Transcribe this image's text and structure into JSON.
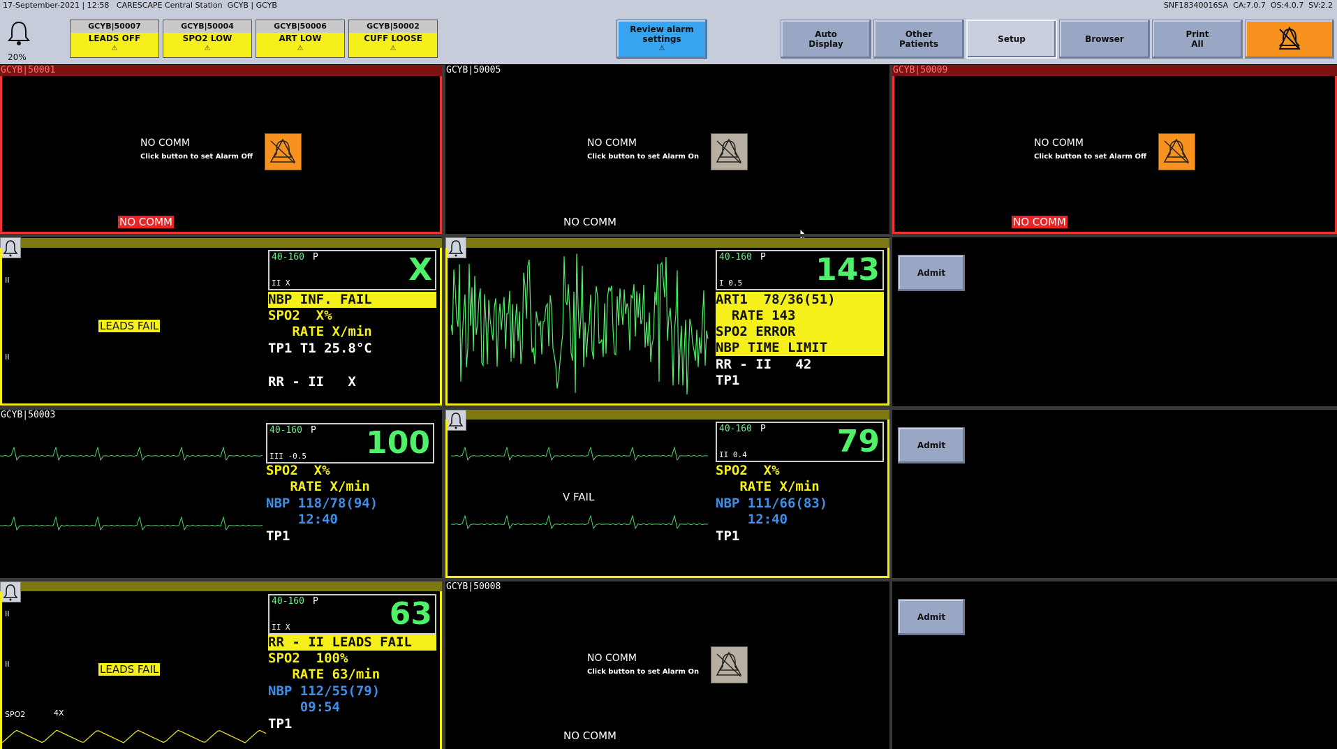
{
  "topbar": {
    "info_left": "17-September-2021 | 12:58   CARESCAPE Central Station  GCYB | GCYB",
    "info_right": "SNF18340016SA  CA:7.0.7  OS:4.0.7  SV:2.2",
    "volume": "20%",
    "bell_icon": "bell-icon"
  },
  "alarm_tiles": [
    {
      "bed": "GCYB|50007",
      "label": "LEADS OFF"
    },
    {
      "bed": "GCYB|50004",
      "label": "SPO2 LOW"
    },
    {
      "bed": "GCYB|50006",
      "label": "ART LOW"
    },
    {
      "bed": "GCYB|50002",
      "label": "CUFF LOOSE"
    }
  ],
  "buttons": {
    "review_alarm_l1": "Review alarm",
    "review_alarm_l2": "settings",
    "auto_display_l1": "Auto",
    "auto_display_l2": "Display",
    "other_patients_l1": "Other",
    "other_patients_l2": "Patients",
    "setup": "Setup",
    "browser": "Browser",
    "print_l1": "Print",
    "print_l2": "All",
    "silence_icon": "alarm-silence-icon"
  },
  "beds": {
    "b50001": {
      "title": "GCYB|50001",
      "nocomm": "NO COMM",
      "click": "Click button to set Alarm Off",
      "status": "NO COMM"
    },
    "b50005": {
      "title": "GCYB|50005",
      "nocomm": "NO COMM",
      "click": "Click button to set Alarm On",
      "status": "NO COMM"
    },
    "b50009": {
      "title": "GCYB|50009",
      "nocomm": "NO COMM",
      "click": "Click button to set Alarm Off",
      "status": "NO COMM"
    },
    "b50008": {
      "title": "GCYB|50008",
      "nocomm": "NO COMM",
      "click": "Click button to set Alarm On",
      "status": "NO COMM"
    },
    "b50003": {
      "title": "GCYB|50003"
    }
  },
  "monitors": {
    "m1": {
      "limits": "40-160",
      "p": "P",
      "lead": "II  X",
      "hr": "X",
      "leads_fail": "LEADS FAIL",
      "lead_label_top": "II",
      "lead_label_bot": "II",
      "lines": [
        "NBP INF. FAIL",
        "SPO2  X%",
        "   RATE X/min",
        "TP1 T1 25.8°C",
        "",
        "RR - II   X"
      ]
    },
    "m2": {
      "limits": "40-160",
      "p": "P",
      "lead": "I 0.5",
      "hr": "143",
      "lines": [
        "ART1  78/36(51)",
        "  RATE 143",
        "SPO2 ERROR",
        "NBP TIME LIMIT",
        "RR - II   42",
        "TP1"
      ]
    },
    "m3": {
      "limits": "40-160",
      "p": "P",
      "lead": "III -0.5",
      "hr": "100",
      "lines": [
        "SPO2  X%",
        "   RATE X/min",
        "NBP 118/78(94)",
        "    12:40",
        "TP1"
      ]
    },
    "m4": {
      "limits": "40-160",
      "p": "P",
      "lead": "II 0.4",
      "hr": "79",
      "vfail": "V FAIL",
      "lines": [
        "SPO2  X%",
        "   RATE X/min",
        "NBP 111/66(83)",
        "    12:40",
        "TP1"
      ]
    },
    "m5": {
      "limits": "40-160",
      "p": "P",
      "lead": "II  X",
      "hr": "63",
      "leads_fail": "LEADS FAIL",
      "lead_label_top": "II",
      "lead_label_bot": "II",
      "spo2_label": "SPO2",
      "spo2_gain": "4X",
      "lines": [
        "RR - II LEADS FAIL",
        "SPO2  100%",
        "   RATE 63/min",
        "NBP 112/55(79)",
        "    09:54",
        "TP1"
      ]
    }
  },
  "admit_label": "Admit",
  "colors": {
    "alarm_yellow": "#f5ef1a",
    "hr_green": "#4ff06a",
    "nbp_blue": "#3f8fe8",
    "nocomm_red": "#ee2222",
    "button_blue": "#38a3ee",
    "button_orange": "#f7921e"
  }
}
